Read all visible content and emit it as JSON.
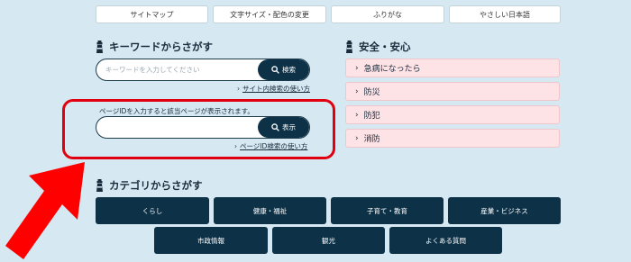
{
  "top_links": [
    "サイトマップ",
    "文字サイズ・配色の変更",
    "ふりがな",
    "やさしい日本語"
  ],
  "keyword_search": {
    "title": "キーワードからさがす",
    "placeholder": "キーワードを入力してください",
    "button_label": "検索",
    "help_link": "サイト内検索の使い方"
  },
  "page_id_search": {
    "caption": "ページIDを入力すると該当ページが表示されます。",
    "placeholder": "",
    "button_label": "表示",
    "help_link": "ページID検索の使い方"
  },
  "safety": {
    "title": "安全・安心",
    "items": [
      "急病になったら",
      "防災",
      "防犯",
      "消防"
    ]
  },
  "category": {
    "title": "カテゴリからさがす",
    "row1": [
      "くらし",
      "健康・福祉",
      "子育て・教育",
      "産業・ビジネス"
    ],
    "row2": [
      "市政情報",
      "観光",
      "よくある質問"
    ]
  },
  "colors": {
    "accent_navy": "#0d3147",
    "background": "#d6e9f2",
    "highlight_red": "#e0000f",
    "safety_pink": "#fde3e6"
  },
  "icons": {
    "section": "lighthouse-icon",
    "search": "magnifier-icon",
    "link": "chevron-right-icon",
    "annotation": "red-arrow-icon"
  }
}
